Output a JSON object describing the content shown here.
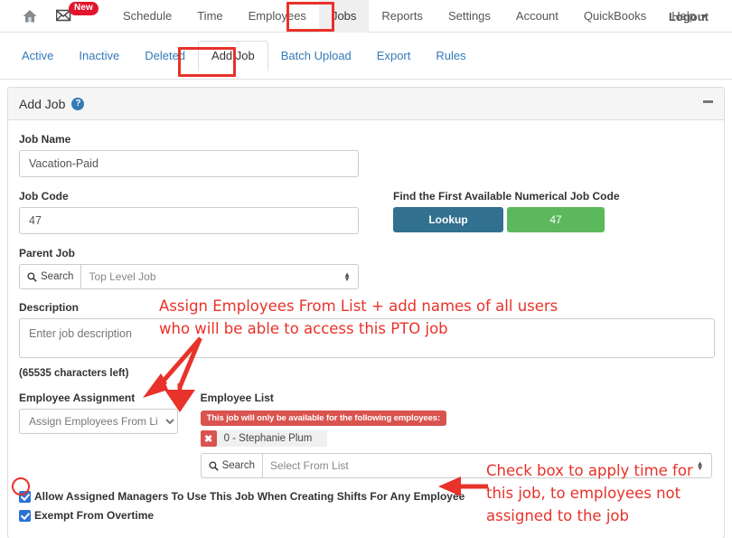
{
  "topnav": {
    "home_icon": "home-icon",
    "mail_icon": "envelope-icon",
    "new_badge": "New",
    "items": [
      {
        "label": "Schedule",
        "active": false
      },
      {
        "label": "Time",
        "active": false
      },
      {
        "label": "Employees",
        "active": false
      },
      {
        "label": "Jobs",
        "active": true
      },
      {
        "label": "Reports",
        "active": false
      },
      {
        "label": "Settings",
        "active": false
      },
      {
        "label": "Account",
        "active": false
      },
      {
        "label": "QuickBooks",
        "active": false
      },
      {
        "label": "Help",
        "active": false,
        "caret": true
      }
    ],
    "logout": "Logout"
  },
  "subnav": {
    "items": [
      {
        "label": "Active",
        "active": false
      },
      {
        "label": "Inactive",
        "active": false
      },
      {
        "label": "Deleted",
        "active": false
      },
      {
        "label": "Add Job",
        "active": true
      },
      {
        "label": "Batch Upload",
        "active": false
      },
      {
        "label": "Export",
        "active": false
      },
      {
        "label": "Rules",
        "active": false
      }
    ]
  },
  "panel": {
    "title": "Add Job",
    "help_icon": "question-mark-icon",
    "collapse_icon": "minus-icon"
  },
  "form": {
    "job_name_label": "Job Name",
    "job_name_value": "Vacation-Paid",
    "job_code_label": "Job Code",
    "job_code_value": "47",
    "lookup_header": "Find the First Available Numerical Job Code",
    "lookup_button": "Lookup",
    "lookup_result": "47",
    "parent_job_label": "Parent Job",
    "parent_job_search": "Search",
    "parent_job_value": "Top Level Job",
    "description_label": "Description",
    "description_placeholder": "Enter job description",
    "description_value": "",
    "chars_left": "(65535 characters left)",
    "employee_assignment_label": "Employee Assignment",
    "employee_assignment_value": "Assign Employees From List",
    "employee_assignment_options": [
      "Assign Employees From List"
    ],
    "employee_list_label": "Employee List",
    "employee_list_alert": "This job will only be available for the following employees:",
    "employee_chips": [
      {
        "remove_icon": "✖",
        "name": "0 - Stephanie Plum"
      }
    ],
    "employee_search_addon": "Search",
    "employee_select_placeholder": "Select From List",
    "checkbox_managers_label": "Allow Assigned Managers To Use This Job When Creating Shifts For Any Employee",
    "checkbox_managers_checked": true,
    "checkbox_exempt_label": "Exempt From Overtime",
    "checkbox_exempt_checked": true
  },
  "annotations": {
    "color": "#e8322a",
    "note_assign": "Assign Employees From List + add names of all users\nwho will be able to access this PTO job",
    "note_checkbox": "Check box to apply time for\nthis job, to employees not\nassigned to the job",
    "highlight_jobs_tab": "Jobs",
    "highlight_addjob_tab": "Add Job"
  }
}
